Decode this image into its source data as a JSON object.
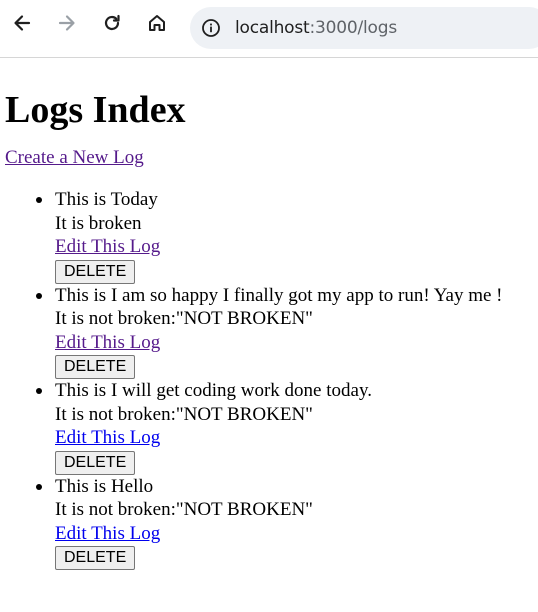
{
  "browser": {
    "url_host": "localhost",
    "url_rest": ":3000/logs",
    "icons": [
      "back-arrow-icon",
      "forward-arrow-icon",
      "reload-icon",
      "home-icon",
      "site-info-icon"
    ]
  },
  "page": {
    "title": "Logs Index",
    "create_link": "Create a New Log",
    "logs": [
      {
        "title_line": "This is Today",
        "status_line": "It is broken",
        "edit_label": "Edit This Log",
        "edit_visited": true,
        "delete_label": "DELETE"
      },
      {
        "title_line": "This is I am so happy I finally got my app to run! Yay me !",
        "status_line": "It is not broken:\"NOT BROKEN\"",
        "edit_label": "Edit This Log",
        "edit_visited": true,
        "delete_label": "DELETE"
      },
      {
        "title_line": "This is I will get coding work done today.",
        "status_line": "It is not broken:\"NOT BROKEN\"",
        "edit_label": "Edit This Log",
        "edit_visited": false,
        "delete_label": "DELETE"
      },
      {
        "title_line": "This is Hello",
        "status_line": "It is not broken:\"NOT BROKEN\"",
        "edit_label": "Edit This Log",
        "edit_visited": false,
        "delete_label": "DELETE"
      }
    ]
  },
  "colors": {
    "link_unvisited": "#0000ee",
    "link_visited": "#551a8b",
    "omnibox_bg": "#eef1f5"
  }
}
